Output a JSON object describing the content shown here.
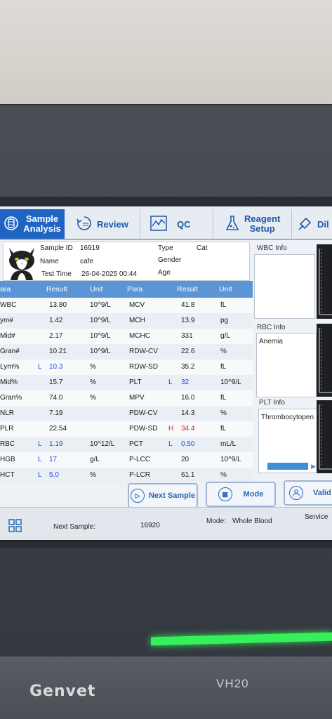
{
  "tabs": [
    {
      "label_line1": "Sample",
      "label_line2": "Analysis",
      "icon": "sample-icon"
    },
    {
      "label": "Review",
      "icon": "review-icon"
    },
    {
      "label": "QC",
      "icon": "qc-chart-icon"
    },
    {
      "label_line1": "Reagent",
      "label_line2": "Setup",
      "icon": "flask-icon"
    },
    {
      "label": "Dil",
      "icon": "diluent-icon"
    }
  ],
  "patient": {
    "sample_id_label": "Sample ID",
    "sample_id": "16919",
    "name_label": "Name",
    "name": "cafe",
    "test_time_label": "Test Time",
    "test_time": "26-04-2025 00:44",
    "type_label": "Type",
    "type": "Cat",
    "gender_label": "Gender",
    "gender": "",
    "age_label": "Age",
    "age": ""
  },
  "table": {
    "headers": [
      "ara",
      "Result",
      "Unit",
      "Para",
      "Result",
      "Unit"
    ],
    "rows": [
      {
        "p1": "WBC",
        "f1": "",
        "r1": "13.80",
        "u1": "10^9/L",
        "p2": "MCV",
        "f2": "",
        "r2": "41.8",
        "u2": "fL"
      },
      {
        "p1": "ym#",
        "f1": "",
        "r1": "1.42",
        "u1": "10^9/L",
        "p2": "MCH",
        "f2": "",
        "r2": "13.9",
        "u2": "pg"
      },
      {
        "p1": "Mid#",
        "f1": "",
        "r1": "2.17",
        "u1": "10^9/L",
        "p2": "MCHC",
        "f2": "",
        "r2": "331",
        "u2": "g/L"
      },
      {
        "p1": "Gran#",
        "f1": "",
        "r1": "10.21",
        "u1": "10^9/L",
        "p2": "RDW-CV",
        "f2": "",
        "r2": "22.6",
        "u2": "%"
      },
      {
        "p1": "Lym%",
        "f1": "L",
        "r1": "10.3",
        "u1": "%",
        "p2": "RDW-SD",
        "f2": "",
        "r2": "35.2",
        "u2": "fL"
      },
      {
        "p1": "Mid%",
        "f1": "",
        "r1": "15.7",
        "u1": "%",
        "p2": "PLT",
        "f2": "L",
        "r2": "32",
        "u2": "10^9/L"
      },
      {
        "p1": "Gran%",
        "f1": "",
        "r1": "74.0",
        "u1": "%",
        "p2": "MPV",
        "f2": "",
        "r2": "16.0",
        "u2": "fL"
      },
      {
        "p1": "NLR",
        "f1": "",
        "r1": "7.19",
        "u1": "",
        "p2": "PDW-CV",
        "f2": "",
        "r2": "14.3",
        "u2": "%"
      },
      {
        "p1": "PLR",
        "f1": "",
        "r1": "22.54",
        "u1": "",
        "p2": "PDW-SD",
        "f2": "H",
        "r2": "34.4",
        "u2": "fL"
      },
      {
        "p1": "RBC",
        "f1": "L",
        "r1": "1.19",
        "u1": "10^12/L",
        "p2": "PCT",
        "f2": "L",
        "r2": "0.50",
        "u2": "mL/L"
      },
      {
        "p1": "HGB",
        "f1": "L",
        "r1": "17",
        "u1": "g/L",
        "p2": "P-LCC",
        "f2": "",
        "r2": "20",
        "u2": "10^9/L"
      },
      {
        "p1": "HCT",
        "f1": "L",
        "r1": "5.0",
        "u1": "%",
        "p2": "P-LCR",
        "f2": "",
        "r2": "61.1",
        "u2": "%"
      }
    ]
  },
  "info": {
    "wbc_title": "WBC Info",
    "wbc_text": "",
    "rbc_title": "RBC Info",
    "rbc_text": "Anemia",
    "plt_title": "PLT Info",
    "plt_text": "Thrombocytopen"
  },
  "buttons": {
    "next_sample": "Next Sample",
    "mode": "Mode",
    "valid": "Valid"
  },
  "status": {
    "next_sample_label": "Next Sample:",
    "next_sample_value": "16920",
    "mode_label": "Mode:",
    "mode_value": "Whole Blood",
    "service": "Service"
  },
  "device": {
    "brand": "Genvet",
    "model": "VH20"
  },
  "colors": {
    "accent": "#1f64c3",
    "low_flag": "#1f4fd6",
    "high_flag": "#dd2222",
    "header": "#5b95d6",
    "indicator_led": "#36f05a"
  }
}
